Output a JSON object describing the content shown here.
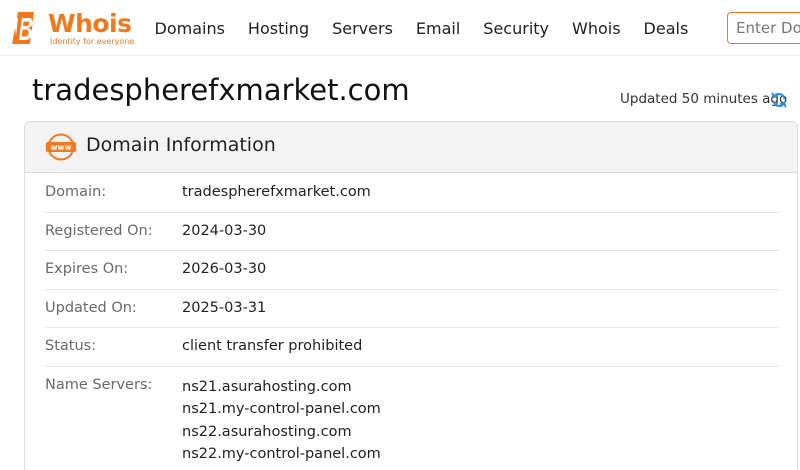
{
  "brand": {
    "name": "Whois",
    "tagline": "Identity for everyone",
    "color": "#f0791e"
  },
  "nav": {
    "items": [
      {
        "label": "Domains"
      },
      {
        "label": "Hosting"
      },
      {
        "label": "Servers"
      },
      {
        "label": "Email"
      },
      {
        "label": "Security"
      },
      {
        "label": "Whois"
      },
      {
        "label": "Deals"
      }
    ]
  },
  "search": {
    "placeholder": "Enter Domain"
  },
  "page": {
    "domain": "tradespherefxmarket.com",
    "updated_text": "Updated 50 minutes ago",
    "refresh_icon": "refresh-icon"
  },
  "card": {
    "icon": "www-icon",
    "title": "Domain Information",
    "rows": [
      {
        "label": "Domain:",
        "value": "tradespherefxmarket.com"
      },
      {
        "label": "Registered On:",
        "value": "2024-03-30"
      },
      {
        "label": "Expires On:",
        "value": "2026-03-30"
      },
      {
        "label": "Updated On:",
        "value": "2025-03-31"
      },
      {
        "label": "Status:",
        "value": "client transfer prohibited"
      }
    ],
    "name_servers": {
      "label": "Name Servers:",
      "values": [
        "ns21.asurahosting.com",
        "ns21.my-control-panel.com",
        "ns22.asurahosting.com",
        "ns22.my-control-panel.com"
      ]
    }
  }
}
